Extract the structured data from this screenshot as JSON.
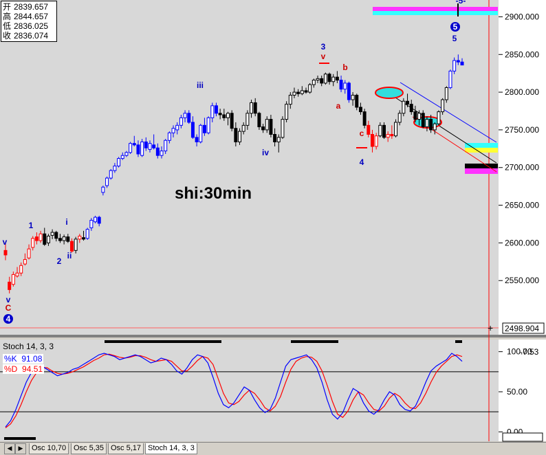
{
  "ohlc": {
    "open_label": "开",
    "open": "2839.657",
    "high_label": "高",
    "high": "2844.657",
    "low_label": "低",
    "low": "2836.025",
    "close_label": "收",
    "close": "2836.074"
  },
  "chart_title": "shi:30min",
  "price_axis": {
    "ticks": [
      "2900.000",
      "2850.000",
      "2800.000",
      "2750.000",
      "2700.000",
      "2650.000",
      "2600.000",
      "2550.000"
    ],
    "current": "2498.904"
  },
  "stoch": {
    "title": "Stoch 14, 3, 3",
    "k_label": "%K",
    "k_value": "91.08",
    "d_label": "%D",
    "d_value": "94.51",
    "ticks": [
      "100.00",
      "50.00",
      "0.00"
    ],
    "last": "-7.53"
  },
  "wave_labels": [
    {
      "text": "v",
      "color": "#0000c0"
    },
    {
      "text": "v",
      "color": "#0000c0"
    },
    {
      "text": "C",
      "color": "#cc0000"
    },
    {
      "text": "4",
      "color": "#ffffff"
    },
    {
      "text": "1",
      "color": "#0000c0"
    },
    {
      "text": "2",
      "color": "#0000c0"
    },
    {
      "text": "i",
      "color": "#0000c0"
    },
    {
      "text": "ii",
      "color": "#0000c0"
    },
    {
      "text": "iii",
      "color": "#0000c0"
    },
    {
      "text": "iv",
      "color": "#0000c0"
    },
    {
      "text": "3",
      "color": "#0000c0"
    },
    {
      "text": "v",
      "color": "#cc0000"
    },
    {
      "text": "b",
      "color": "#cc0000"
    },
    {
      "text": "a",
      "color": "#cc0000"
    },
    {
      "text": "c",
      "color": "#cc0000"
    },
    {
      "text": "4",
      "color": "#0000c0"
    },
    {
      "text": "5",
      "color": "#ffffff"
    },
    {
      "text": "5",
      "color": "#0000c0"
    },
    {
      "text": "-5-",
      "color": "#0000c0"
    }
  ],
  "tabs": [
    "Osc 10,70",
    "Osc 5,35",
    "Osc 5,17",
    "Stoch 14, 3, 3"
  ],
  "chart_data": {
    "type": "candlestick",
    "title": "shi:30min",
    "ylim": [
      2490,
      2915
    ],
    "candles": [
      {
        "o": 2590,
        "h": 2600,
        "l": 2577,
        "c": 2584,
        "color": "red"
      },
      {
        "o": 2548,
        "h": 2555,
        "l": 2533,
        "c": 2538,
        "color": "red"
      },
      {
        "o": 2545,
        "h": 2562,
        "l": 2542,
        "c": 2558,
        "color": "red"
      },
      {
        "o": 2556,
        "h": 2568,
        "l": 2554,
        "c": 2560,
        "color": "red"
      },
      {
        "o": 2560,
        "h": 2574,
        "l": 2556,
        "c": 2570,
        "color": "red"
      },
      {
        "o": 2572,
        "h": 2586,
        "l": 2570,
        "c": 2578,
        "color": "red"
      },
      {
        "o": 2580,
        "h": 2598,
        "l": 2578,
        "c": 2592,
        "color": "red"
      },
      {
        "o": 2594,
        "h": 2609,
        "l": 2590,
        "c": 2606,
        "color": "red"
      },
      {
        "o": 2608,
        "h": 2614,
        "l": 2598,
        "c": 2603,
        "color": "red"
      },
      {
        "o": 2603,
        "h": 2616,
        "l": 2600,
        "c": 2612,
        "color": "red"
      },
      {
        "o": 2612,
        "h": 2620,
        "l": 2596,
        "c": 2598,
        "color": "black"
      },
      {
        "o": 2600,
        "h": 2612,
        "l": 2596,
        "c": 2609,
        "color": "black"
      },
      {
        "o": 2610,
        "h": 2618,
        "l": 2605,
        "c": 2614,
        "color": "black"
      },
      {
        "o": 2614,
        "h": 2616,
        "l": 2602,
        "c": 2606,
        "color": "black"
      },
      {
        "o": 2606,
        "h": 2612,
        "l": 2600,
        "c": 2603,
        "color": "black"
      },
      {
        "o": 2603,
        "h": 2611,
        "l": 2598,
        "c": 2608,
        "color": "black"
      },
      {
        "o": 2608,
        "h": 2612,
        "l": 2600,
        "c": 2602,
        "color": "black"
      },
      {
        "o": 2602,
        "h": 2606,
        "l": 2587,
        "c": 2589,
        "color": "red"
      },
      {
        "o": 2590,
        "h": 2608,
        "l": 2586,
        "c": 2605,
        "color": "black"
      },
      {
        "o": 2605,
        "h": 2612,
        "l": 2600,
        "c": 2609,
        "color": "red"
      },
      {
        "o": 2607,
        "h": 2616,
        "l": 2603,
        "c": 2605,
        "color": "black"
      },
      {
        "o": 2606,
        "h": 2620,
        "l": 2604,
        "c": 2618,
        "color": "blue"
      },
      {
        "o": 2620,
        "h": 2633,
        "l": 2616,
        "c": 2630,
        "color": "blue"
      },
      {
        "o": 2628,
        "h": 2636,
        "l": 2626,
        "c": 2634,
        "color": "blue"
      },
      {
        "o": 2634,
        "h": 2636,
        "l": 2622,
        "c": 2626,
        "color": "blue"
      },
      {
        "o": 2667,
        "h": 2676,
        "l": 2663,
        "c": 2674,
        "color": "blue"
      },
      {
        "o": 2676,
        "h": 2688,
        "l": 2673,
        "c": 2686,
        "color": "blue"
      },
      {
        "o": 2686,
        "h": 2698,
        "l": 2684,
        "c": 2696,
        "color": "blue"
      },
      {
        "o": 2696,
        "h": 2706,
        "l": 2693,
        "c": 2702,
        "color": "blue"
      },
      {
        "o": 2702,
        "h": 2714,
        "l": 2700,
        "c": 2712,
        "color": "blue"
      },
      {
        "o": 2712,
        "h": 2720,
        "l": 2710,
        "c": 2716,
        "color": "blue"
      },
      {
        "o": 2716,
        "h": 2722,
        "l": 2714,
        "c": 2720,
        "color": "blue"
      },
      {
        "o": 2720,
        "h": 2734,
        "l": 2718,
        "c": 2732,
        "color": "blue"
      },
      {
        "o": 2732,
        "h": 2742,
        "l": 2728,
        "c": 2730,
        "color": "blue"
      },
      {
        "o": 2730,
        "h": 2736,
        "l": 2714,
        "c": 2718,
        "color": "blue"
      },
      {
        "o": 2716,
        "h": 2738,
        "l": 2714,
        "c": 2734,
        "color": "blue"
      },
      {
        "o": 2734,
        "h": 2740,
        "l": 2722,
        "c": 2726,
        "color": "blue"
      },
      {
        "o": 2724,
        "h": 2736,
        "l": 2720,
        "c": 2732,
        "color": "blue"
      },
      {
        "o": 2730,
        "h": 2744,
        "l": 2724,
        "c": 2726,
        "color": "blue"
      },
      {
        "o": 2726,
        "h": 2732,
        "l": 2712,
        "c": 2716,
        "color": "blue"
      },
      {
        "o": 2716,
        "h": 2728,
        "l": 2712,
        "c": 2722,
        "color": "blue"
      },
      {
        "o": 2722,
        "h": 2738,
        "l": 2718,
        "c": 2736,
        "color": "blue"
      },
      {
        "o": 2736,
        "h": 2748,
        "l": 2732,
        "c": 2746,
        "color": "blue"
      },
      {
        "o": 2746,
        "h": 2756,
        "l": 2740,
        "c": 2752,
        "color": "blue"
      },
      {
        "o": 2750,
        "h": 2760,
        "l": 2744,
        "c": 2756,
        "color": "blue"
      },
      {
        "o": 2756,
        "h": 2770,
        "l": 2752,
        "c": 2766,
        "color": "blue"
      },
      {
        "o": 2766,
        "h": 2776,
        "l": 2760,
        "c": 2772,
        "color": "blue"
      },
      {
        "o": 2772,
        "h": 2776,
        "l": 2758,
        "c": 2760,
        "color": "blue"
      },
      {
        "o": 2760,
        "h": 2768,
        "l": 2738,
        "c": 2740,
        "color": "blue"
      },
      {
        "o": 2740,
        "h": 2744,
        "l": 2728,
        "c": 2734,
        "color": "blue"
      },
      {
        "o": 2734,
        "h": 2758,
        "l": 2732,
        "c": 2756,
        "color": "blue"
      },
      {
        "o": 2756,
        "h": 2766,
        "l": 2742,
        "c": 2746,
        "color": "blue"
      },
      {
        "o": 2746,
        "h": 2768,
        "l": 2744,
        "c": 2766,
        "color": "blue"
      },
      {
        "o": 2766,
        "h": 2786,
        "l": 2760,
        "c": 2782,
        "color": "blue"
      },
      {
        "o": 2782,
        "h": 2786,
        "l": 2768,
        "c": 2772,
        "color": "blue"
      },
      {
        "o": 2772,
        "h": 2778,
        "l": 2764,
        "c": 2770,
        "color": "black"
      },
      {
        "o": 2770,
        "h": 2778,
        "l": 2762,
        "c": 2766,
        "color": "black"
      },
      {
        "o": 2766,
        "h": 2774,
        "l": 2756,
        "c": 2772,
        "color": "black"
      },
      {
        "o": 2772,
        "h": 2776,
        "l": 2748,
        "c": 2752,
        "color": "black"
      },
      {
        "o": 2752,
        "h": 2760,
        "l": 2728,
        "c": 2734,
        "color": "black"
      },
      {
        "o": 2734,
        "h": 2752,
        "l": 2730,
        "c": 2748,
        "color": "black"
      },
      {
        "o": 2748,
        "h": 2760,
        "l": 2744,
        "c": 2756,
        "color": "black"
      },
      {
        "o": 2756,
        "h": 2776,
        "l": 2750,
        "c": 2772,
        "color": "black"
      },
      {
        "o": 2772,
        "h": 2790,
        "l": 2766,
        "c": 2786,
        "color": "black"
      },
      {
        "o": 2786,
        "h": 2792,
        "l": 2768,
        "c": 2772,
        "color": "black"
      },
      {
        "o": 2772,
        "h": 2774,
        "l": 2750,
        "c": 2754,
        "color": "black"
      },
      {
        "o": 2754,
        "h": 2758,
        "l": 2746,
        "c": 2750,
        "color": "black"
      },
      {
        "o": 2750,
        "h": 2768,
        "l": 2746,
        "c": 2764,
        "color": "black"
      },
      {
        "o": 2764,
        "h": 2770,
        "l": 2740,
        "c": 2744,
        "color": "black"
      },
      {
        "o": 2744,
        "h": 2752,
        "l": 2728,
        "c": 2734,
        "color": "black"
      },
      {
        "o": 2734,
        "h": 2744,
        "l": 2720,
        "c": 2740,
        "color": "black"
      },
      {
        "o": 2740,
        "h": 2768,
        "l": 2738,
        "c": 2764,
        "color": "black"
      },
      {
        "o": 2764,
        "h": 2788,
        "l": 2760,
        "c": 2784,
        "color": "black"
      },
      {
        "o": 2784,
        "h": 2800,
        "l": 2778,
        "c": 2796,
        "color": "black"
      },
      {
        "o": 2796,
        "h": 2806,
        "l": 2792,
        "c": 2800,
        "color": "black"
      },
      {
        "o": 2800,
        "h": 2804,
        "l": 2794,
        "c": 2798,
        "color": "black"
      },
      {
        "o": 2798,
        "h": 2808,
        "l": 2796,
        "c": 2802,
        "color": "black"
      },
      {
        "o": 2802,
        "h": 2806,
        "l": 2798,
        "c": 2800,
        "color": "black"
      },
      {
        "o": 2800,
        "h": 2812,
        "l": 2798,
        "c": 2810,
        "color": "black"
      },
      {
        "o": 2810,
        "h": 2818,
        "l": 2806,
        "c": 2816,
        "color": "black"
      },
      {
        "o": 2816,
        "h": 2822,
        "l": 2812,
        "c": 2818,
        "color": "black"
      },
      {
        "o": 2818,
        "h": 2822,
        "l": 2808,
        "c": 2812,
        "color": "black"
      },
      {
        "o": 2812,
        "h": 2826,
        "l": 2810,
        "c": 2824,
        "color": "black"
      },
      {
        "o": 2824,
        "h": 2826,
        "l": 2810,
        "c": 2814,
        "color": "black"
      },
      {
        "o": 2814,
        "h": 2824,
        "l": 2808,
        "c": 2820,
        "color": "black"
      },
      {
        "o": 2820,
        "h": 2828,
        "l": 2812,
        "c": 2816,
        "color": "black"
      },
      {
        "o": 2816,
        "h": 2822,
        "l": 2800,
        "c": 2804,
        "color": "blue"
      },
      {
        "o": 2804,
        "h": 2816,
        "l": 2798,
        "c": 2812,
        "color": "blue"
      },
      {
        "o": 2812,
        "h": 2814,
        "l": 2786,
        "c": 2790,
        "color": "blue"
      },
      {
        "o": 2790,
        "h": 2800,
        "l": 2782,
        "c": 2796,
        "color": "black"
      },
      {
        "o": 2796,
        "h": 2798,
        "l": 2776,
        "c": 2780,
        "color": "black"
      },
      {
        "o": 2780,
        "h": 2786,
        "l": 2770,
        "c": 2774,
        "color": "black"
      },
      {
        "o": 2774,
        "h": 2778,
        "l": 2752,
        "c": 2756,
        "color": "black"
      },
      {
        "o": 2756,
        "h": 2762,
        "l": 2740,
        "c": 2744,
        "color": "red"
      },
      {
        "o": 2744,
        "h": 2750,
        "l": 2720,
        "c": 2728,
        "color": "red"
      },
      {
        "o": 2728,
        "h": 2746,
        "l": 2724,
        "c": 2742,
        "color": "red"
      },
      {
        "o": 2742,
        "h": 2760,
        "l": 2740,
        "c": 2756,
        "color": "black"
      },
      {
        "o": 2756,
        "h": 2760,
        "l": 2738,
        "c": 2740,
        "color": "black"
      },
      {
        "o": 2740,
        "h": 2748,
        "l": 2734,
        "c": 2744,
        "color": "red"
      },
      {
        "o": 2744,
        "h": 2756,
        "l": 2738,
        "c": 2742,
        "color": "red"
      },
      {
        "o": 2742,
        "h": 2764,
        "l": 2740,
        "c": 2760,
        "color": "black"
      },
      {
        "o": 2760,
        "h": 2776,
        "l": 2756,
        "c": 2772,
        "color": "black"
      },
      {
        "o": 2772,
        "h": 2792,
        "l": 2768,
        "c": 2788,
        "color": "black"
      },
      {
        "o": 2788,
        "h": 2798,
        "l": 2780,
        "c": 2784,
        "color": "black"
      },
      {
        "o": 2784,
        "h": 2790,
        "l": 2770,
        "c": 2774,
        "color": "black"
      },
      {
        "o": 2774,
        "h": 2782,
        "l": 2760,
        "c": 2764,
        "color": "black"
      },
      {
        "o": 2764,
        "h": 2776,
        "l": 2756,
        "c": 2772,
        "color": "black"
      },
      {
        "o": 2772,
        "h": 2776,
        "l": 2752,
        "c": 2754,
        "color": "black"
      },
      {
        "o": 2754,
        "h": 2768,
        "l": 2748,
        "c": 2764,
        "color": "black"
      },
      {
        "o": 2764,
        "h": 2770,
        "l": 2746,
        "c": 2750,
        "color": "black"
      },
      {
        "o": 2750,
        "h": 2760,
        "l": 2744,
        "c": 2758,
        "color": "black"
      },
      {
        "o": 2758,
        "h": 2776,
        "l": 2756,
        "c": 2774,
        "color": "black"
      },
      {
        "o": 2774,
        "h": 2792,
        "l": 2770,
        "c": 2790,
        "color": "black"
      },
      {
        "o": 2790,
        "h": 2808,
        "l": 2786,
        "c": 2806,
        "color": "black"
      },
      {
        "o": 2806,
        "h": 2830,
        "l": 2804,
        "c": 2828,
        "color": "blue"
      },
      {
        "o": 2828,
        "h": 2846,
        "l": 2824,
        "c": 2842,
        "color": "blue"
      },
      {
        "o": 2842,
        "h": 2850,
        "l": 2836,
        "c": 2840,
        "color": "blue"
      },
      {
        "o": 2840,
        "h": 2845,
        "l": 2836,
        "c": 2836,
        "color": "blue"
      }
    ],
    "stoch_k": [
      6,
      14,
      28,
      45,
      62,
      74,
      80,
      82,
      78,
      74,
      70,
      72,
      74,
      78,
      80,
      84,
      88,
      92,
      96,
      98,
      96,
      94,
      90,
      92,
      94,
      96,
      94,
      90,
      86,
      88,
      92,
      90,
      84,
      76,
      72,
      80,
      90,
      96,
      94,
      86,
      68,
      48,
      34,
      30,
      36,
      46,
      56,
      52,
      40,
      30,
      24,
      28,
      42,
      62,
      82,
      90,
      92,
      94,
      96,
      90,
      80,
      62,
      40,
      22,
      16,
      24,
      40,
      54,
      50,
      36,
      26,
      22,
      28,
      40,
      50,
      46,
      34,
      28,
      26,
      32,
      46,
      62,
      76,
      82,
      86,
      90,
      98,
      94,
      88
    ],
    "stoch_d": [
      5,
      10,
      20,
      34,
      50,
      64,
      74,
      80,
      80,
      76,
      73,
      72,
      73,
      75,
      78,
      81,
      85,
      89,
      92,
      96,
      97,
      95,
      93,
      92,
      93,
      95,
      95,
      93,
      90,
      88,
      89,
      90,
      88,
      82,
      76,
      76,
      82,
      89,
      94,
      92,
      84,
      66,
      48,
      36,
      34,
      38,
      46,
      52,
      48,
      40,
      30,
      26,
      32,
      44,
      62,
      78,
      88,
      92,
      94,
      93,
      88,
      76,
      58,
      38,
      22,
      18,
      26,
      40,
      50,
      46,
      36,
      28,
      26,
      32,
      42,
      48,
      44,
      36,
      30,
      29,
      36,
      48,
      62,
      74,
      82,
      88,
      94,
      96,
      94
    ],
    "stoch_ylim": [
      -10,
      110
    ]
  }
}
